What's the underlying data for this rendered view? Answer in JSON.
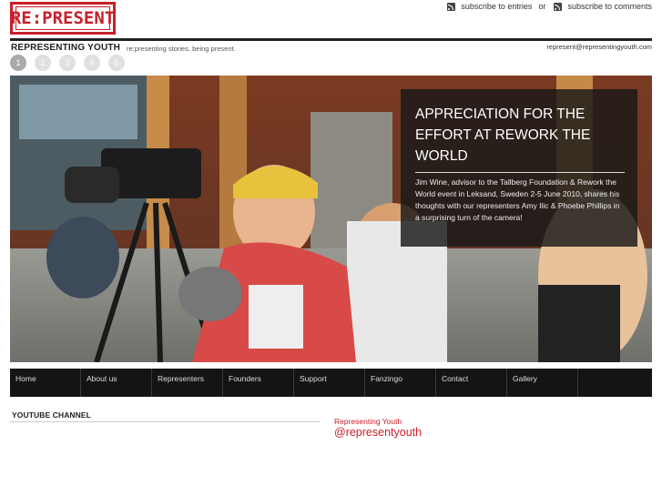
{
  "header": {
    "logo_text": "RE:PRESENT",
    "subscribe_entries": "subscribe to entries",
    "subscribe_separator": "or",
    "subscribe_comments": "subscribe to comments",
    "site_title": "REPRESENTING YOUTH",
    "tagline": "re:presenting stories. being present.",
    "email": "represent@representingyouth.com"
  },
  "slider": {
    "dots": [
      "1",
      "2",
      "3",
      "4",
      "5"
    ],
    "active_index": 0
  },
  "hero": {
    "title": "APPRECIATION FOR THE EFFORT AT REWORK THE WORLD",
    "text": "Jim Wine, advisor to the Tallberg Foundation & Rework the World event in Leksand, Sweden 2-5 June 2010, shares his thoughts with our representers Amy Ilic & Phoebe Phillips in a surprising turn of the camera!"
  },
  "nav": {
    "items": [
      "Home",
      "About us",
      "Representers",
      "Founders",
      "Support",
      "Fanzingo",
      "Contact",
      "Gallery",
      ""
    ]
  },
  "youtube": {
    "title": "YOUTUBE CHANNEL"
  },
  "twitter": {
    "name": "Representing Youth",
    "handle": "@representyouth"
  },
  "colors": {
    "brand_red": "#c8202a",
    "nav_bg": "#141414"
  }
}
